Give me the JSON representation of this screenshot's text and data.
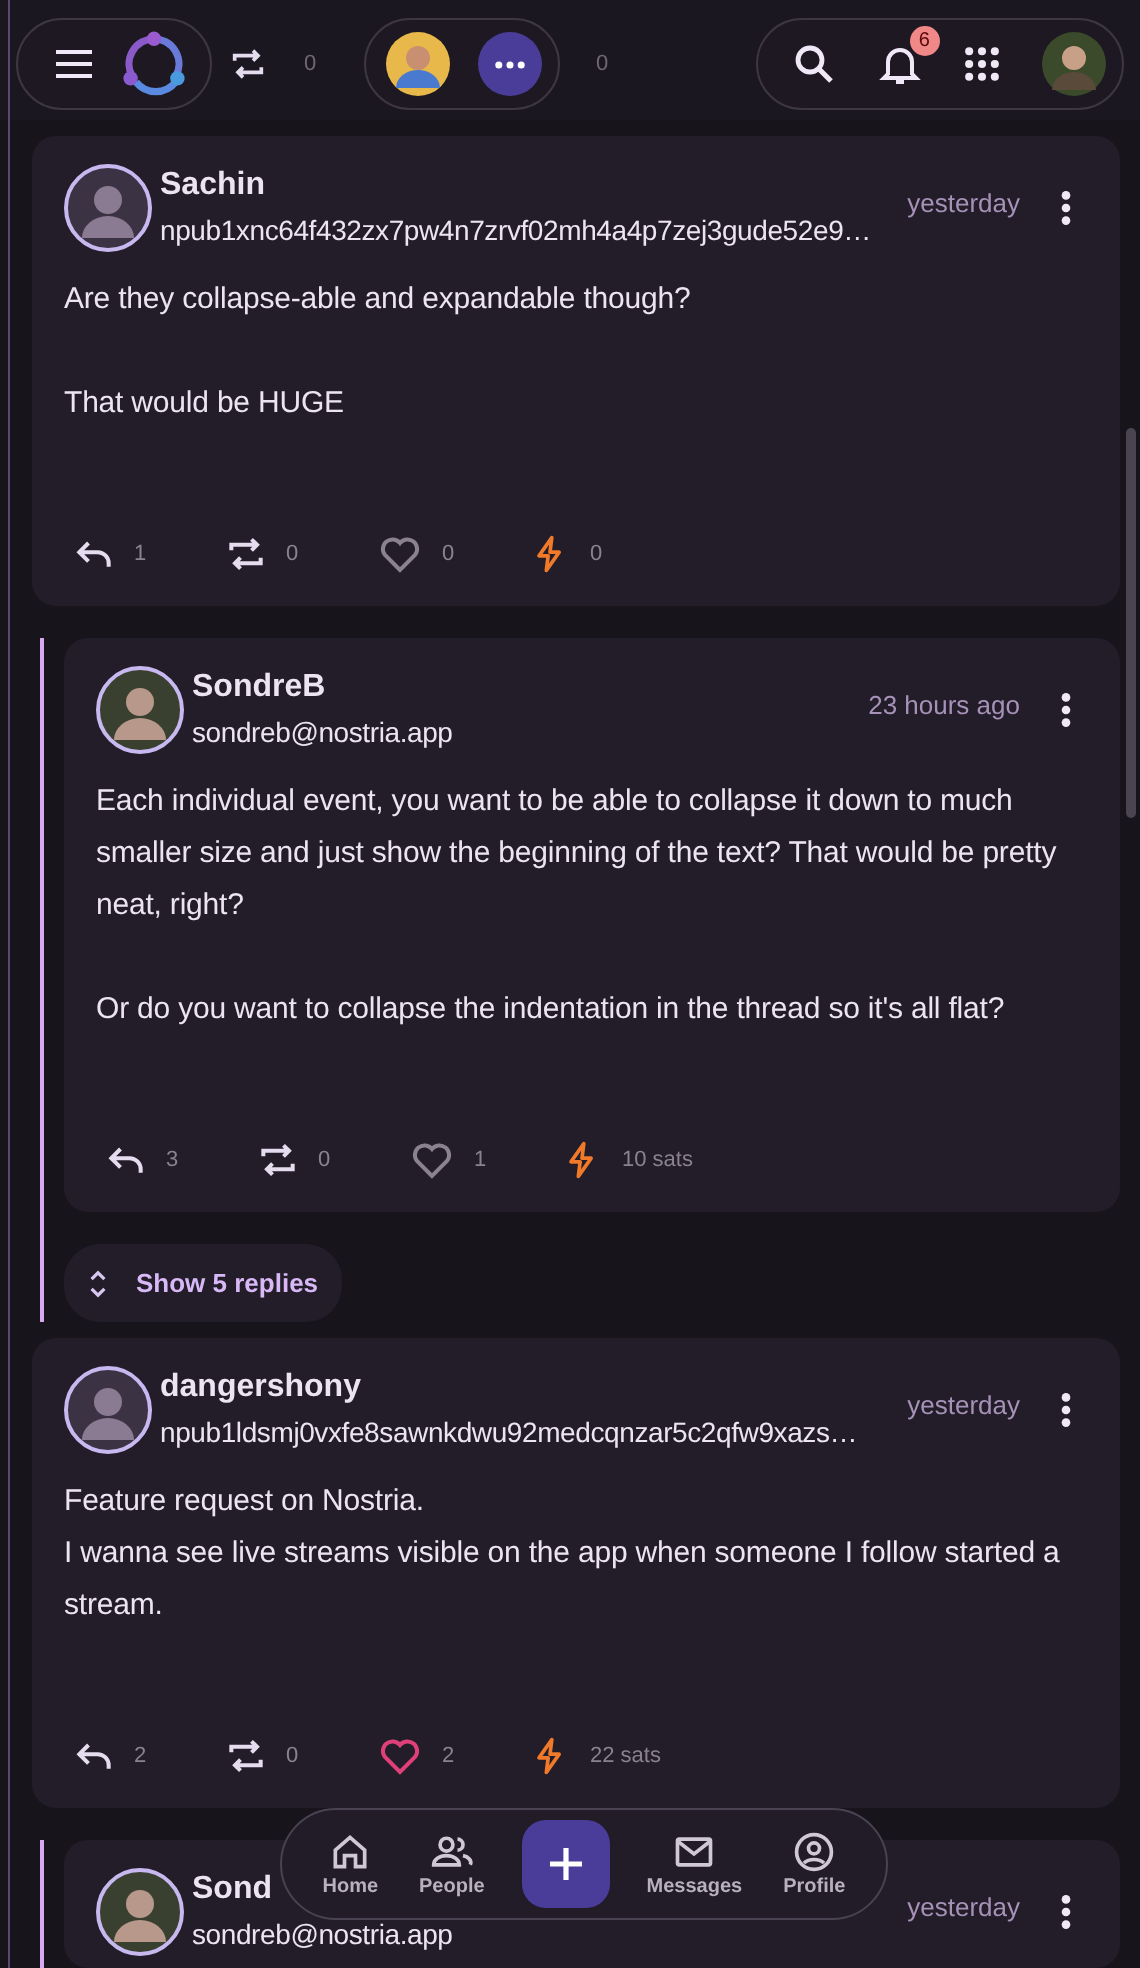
{
  "top_bar": {
    "background_counts": [
      "0",
      "0"
    ],
    "notification_badge": "6"
  },
  "thread": [
    {
      "author": "Sachin",
      "handle": "npub1xnc64f432zx7pw4n7zrvf02mh4a4p7zej3gude52e9…",
      "time": "yesterday",
      "paragraphs": [
        "Are they collapse-able and expandable though?",
        "That would be HUGE"
      ],
      "actions": {
        "replies": "1",
        "reposts": "0",
        "likes": "0",
        "liked": false,
        "zaps": "0"
      },
      "children": [
        {
          "author": "SondreB",
          "handle": "sondreb@nostria.app",
          "time": "23 hours ago",
          "paragraphs": [
            "Each individual event, you want to be able to collapse it down to much smaller size and just show the beginning of the text? That would be pretty neat, right?",
            "Or do you want to collapse the indentation in the thread so it's all flat?"
          ],
          "actions": {
            "replies": "3",
            "reposts": "0",
            "likes": "1",
            "liked": false,
            "zaps": "10 sats"
          }
        }
      ],
      "more_replies": "Show 5 replies"
    },
    {
      "author": "dangershony",
      "handle": "npub1ldsmj0vxfe8sawnkdwu92medcqnzar5c2qfw9xazs…",
      "time": "yesterday",
      "paragraphs": [
        "Feature request on Nostria.\nI wanna see live streams visible on the app when someone I follow started a stream."
      ],
      "actions": {
        "replies": "2",
        "reposts": "0",
        "likes": "2",
        "liked": true,
        "zaps": "22 sats"
      },
      "children": [
        {
          "author": "Sond",
          "handle": "sondreb@nostria.app",
          "time": "yesterday"
        }
      ]
    }
  ],
  "bottom_nav": [
    {
      "kind": "home",
      "label": "Home"
    },
    {
      "kind": "people",
      "label": "People"
    },
    {
      "kind": "compose"
    },
    {
      "kind": "messages",
      "label": "Messages"
    },
    {
      "kind": "profile",
      "label": "Profile"
    }
  ]
}
